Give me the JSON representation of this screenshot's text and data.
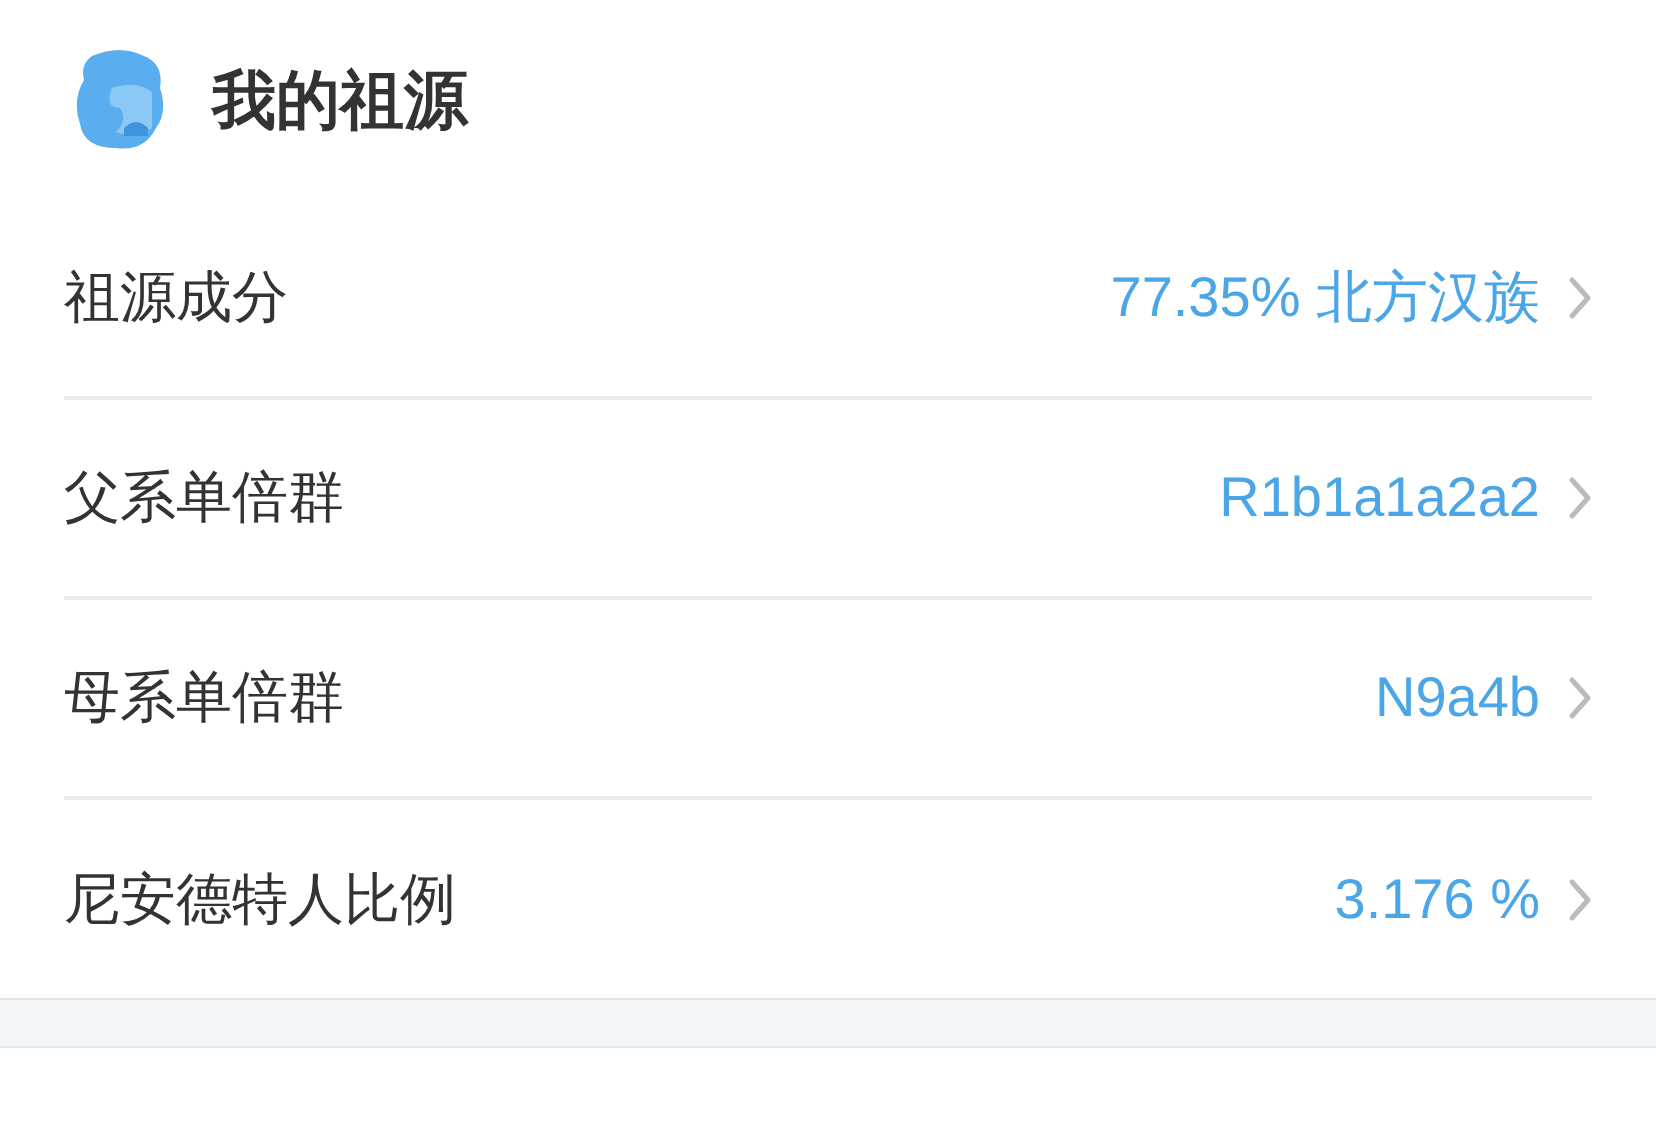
{
  "header": {
    "title": "我的祖源"
  },
  "rows": [
    {
      "label": "祖源成分",
      "value": "77.35% 北方汉族"
    },
    {
      "label": "父系单倍群",
      "value": "R1b1a1a2a2"
    },
    {
      "label": "母系单倍群",
      "value": "N9a4b"
    },
    {
      "label": "尼安德特人比例",
      "value": "3.176 %"
    }
  ]
}
